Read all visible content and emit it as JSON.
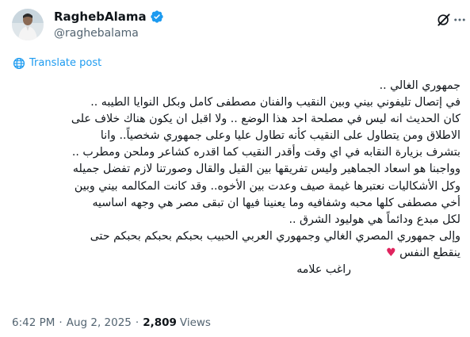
{
  "author": {
    "display_name": "RaghebAlama",
    "handle": "@raghebalama"
  },
  "translate_label": "Translate post",
  "tweet_lines": [
    "جمهوري الغالي ..",
    "في إتصال تليفوني بيني وبين النقيب والفنان مصطفى كامل وبكل النوايا الطيبه ..",
    "كان الحديث انه ليس في مصلحة احد هذا الوضع .. ولا اقبل ان يكون هناك خلاف على",
    "الاطلاق ومن يتطاول على النقيب كأنه تطاول عليا وعلى جمهوري شخصياً.. وانا",
    "بتشرف بزيارة النقابه في اي وقت وأقدر النقيب كما اقدره كشاعر وملحن ومطرب ..",
    "وواجبنا هو اسعاد الجماهير وليس تفريقها بين القيل والقال وصورتنا لازم تفضل جميله",
    "وكل الأشكاليات نعتبرها غيمة صيف وعدت بين الأخوه.. وقد كانت المكالمه بيني وبين",
    "أخي مصطفى كلها محبه وشفافيه وما يعنينا فيها ان تبقى مصر هي وجهه اساسيه",
    "لكل مبدع ودائماً هي هوليود الشرق ..",
    "وإلى جمهوري المصري الغالي وجمهوري العربي الحبيب بحبكم بحبكم بحبكم حتى",
    "ينقطع النفس",
    "راغب علامه"
  ],
  "heart_emoji": "♥",
  "meta": {
    "time": "6:42 PM",
    "separator": "·",
    "date": "Aug 2, 2025",
    "views_count": "2,809",
    "views_label": "Views"
  },
  "icons": {
    "verified": "verified-badge-icon",
    "grok": "grok-icon",
    "more": "more-icon",
    "translate": "globe-icon"
  },
  "colors": {
    "accent": "#1d9bf0",
    "muted": "#536471",
    "text": "#0f1419",
    "heart": "#e0245e"
  }
}
